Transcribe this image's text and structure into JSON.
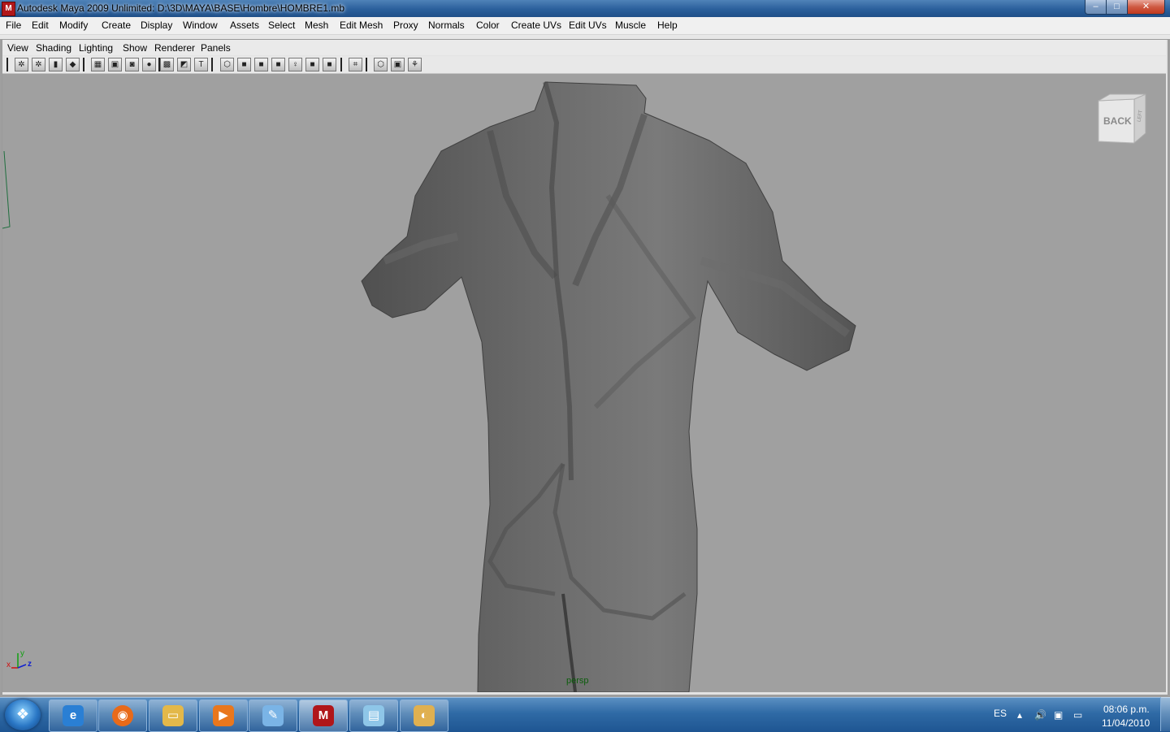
{
  "window": {
    "app_icon": "maya-logo-icon",
    "title": "Autodesk Maya 2009 Unlimited: D:\\3D\\MAYA\\BASE\\Hombre\\HOMBRE1.mb",
    "minimize": "–",
    "maximize": "□",
    "close": "✕"
  },
  "menu": [
    "File",
    "Edit",
    "Modify",
    "Create",
    "Display",
    "Window",
    "Assets",
    "Select",
    "Mesh",
    "Edit Mesh",
    "Proxy",
    "Normals",
    "Color",
    "Create UVs",
    "Edit UVs",
    "Muscle",
    "Help"
  ],
  "panel_menu": [
    "View",
    "Shading",
    "Lighting",
    "Show",
    "Renderer",
    "Panels"
  ],
  "toolbar_icons": [
    "select-camera-icon",
    "lock-camera-icon",
    "bookmark-icon",
    "image-plane-icon",
    "grid-icon",
    "film-gate-icon",
    "resolution-gate-icon",
    "safe-title-icon",
    "wireframe-icon",
    "textured-icon",
    "texture-tile-icon",
    "smooth-shade-icon",
    "flat-shade-icon",
    "xray-icon",
    "light-icon",
    "shadow-icon",
    "render-icon",
    "isolate-icon",
    "camera-icon",
    "hud-icon",
    "manipulator-icon"
  ],
  "viewport": {
    "background": "#a0a0a0",
    "viewcube_label": "BACK",
    "viewcube_side": "LEFT",
    "camera_label": "persp",
    "axis": {
      "x": "x",
      "y": "y",
      "z": "z"
    }
  },
  "taskbar": {
    "start_icon": "windows-start-icon",
    "tasks": [
      {
        "icon": "internet-explorer-icon",
        "glyph": "e",
        "color": "#2a7fd4"
      },
      {
        "icon": "firefox-icon",
        "glyph": "◉",
        "color": "#e86a1a"
      },
      {
        "icon": "folder-icon",
        "glyph": "▭",
        "color": "#e3b84a"
      },
      {
        "icon": "media-player-icon",
        "glyph": "▶",
        "color": "#e9771d"
      },
      {
        "icon": "paint-tool-icon",
        "glyph": "✎",
        "color": "#7ab4e6"
      },
      {
        "icon": "maya-app-icon",
        "glyph": "M",
        "color": "#b0161a"
      },
      {
        "icon": "notepad-icon",
        "glyph": "▤",
        "color": "#8ec6e8"
      },
      {
        "icon": "paint-palette-icon",
        "glyph": "◐",
        "color": "#e0b050"
      }
    ],
    "language": "ES",
    "tray_icons": [
      "show-hidden-icons-icon",
      "volume-icon",
      "network-error-icon",
      "action-center-icon"
    ],
    "time": "08:06 p.m.",
    "date": "11/04/2010"
  }
}
